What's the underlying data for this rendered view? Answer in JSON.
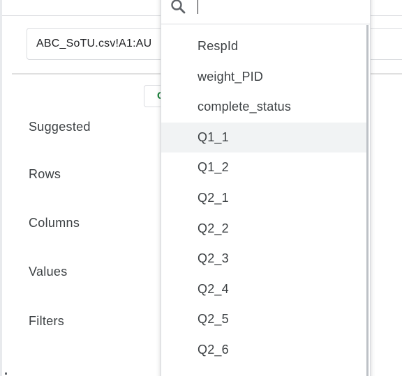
{
  "editor": {
    "data_range": "ABC_SoTU.csv!A1:AU",
    "chip_label": "G",
    "sections": {
      "suggested": "Suggested",
      "rows": "Rows",
      "columns": "Columns",
      "values": "Values",
      "filters": "Filters"
    }
  },
  "dropdown": {
    "search": {
      "icon": "search-icon",
      "value": "",
      "placeholder": ""
    },
    "hovered_index": 3,
    "items": [
      "RespId",
      "weight_PID",
      "complete_status",
      "Q1_1",
      "Q1_2",
      "Q2_1",
      "Q2_2",
      "Q2_3",
      "Q2_4",
      "Q2_5",
      "Q2_6"
    ]
  }
}
